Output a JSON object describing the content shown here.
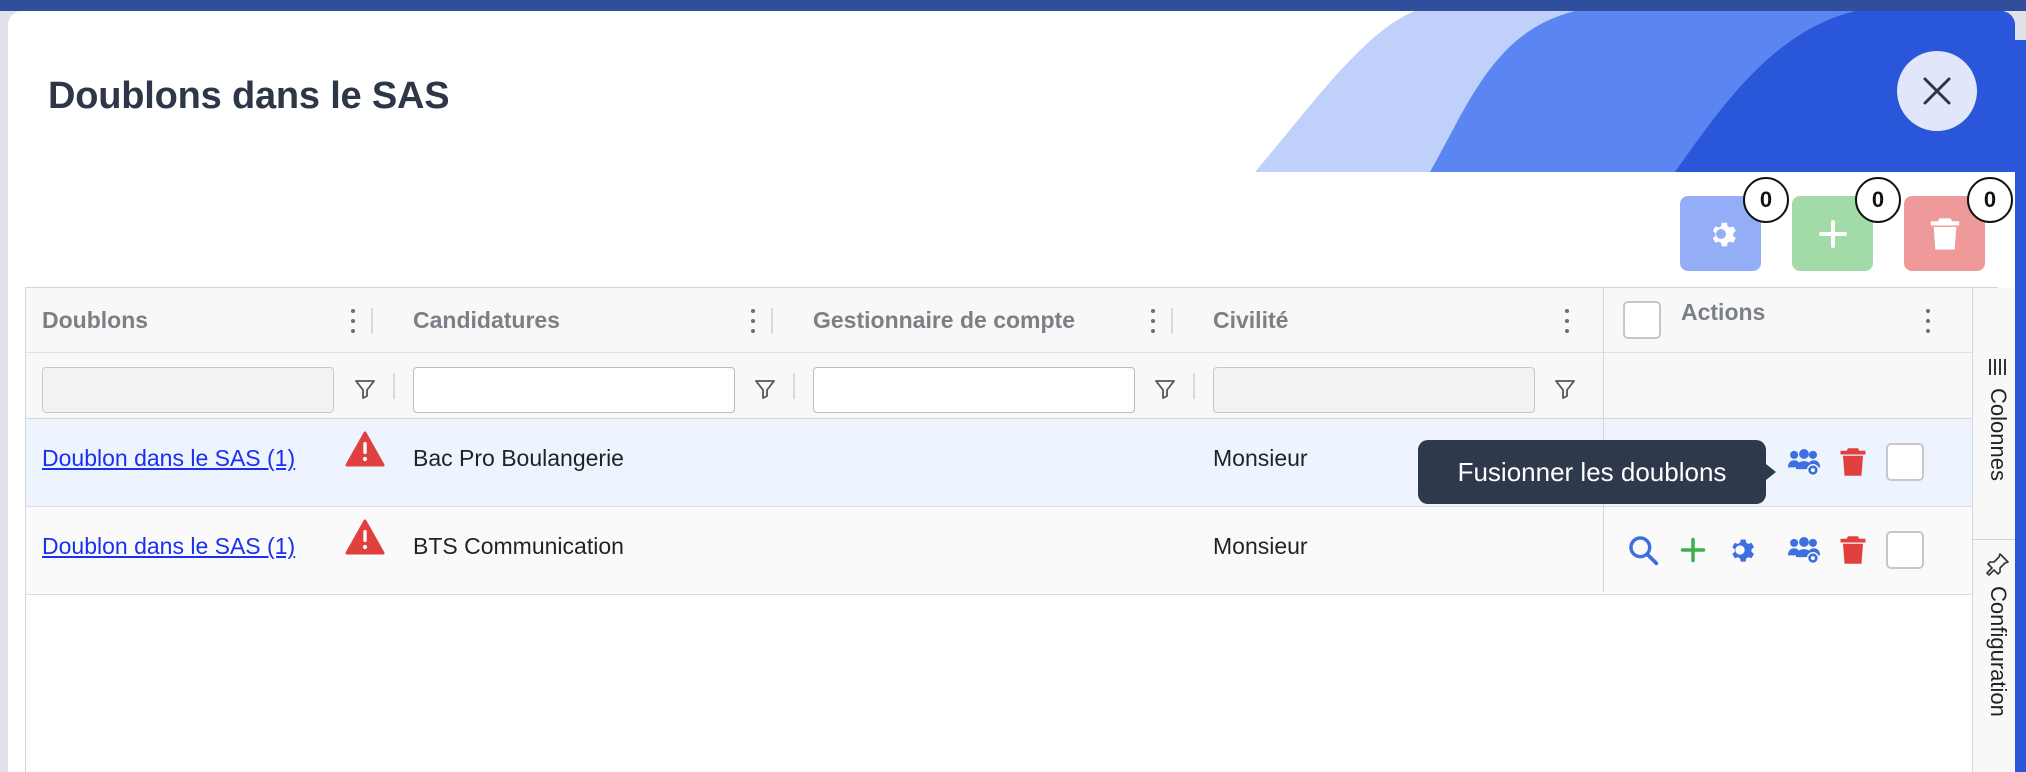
{
  "modal": {
    "title": "Doublons dans le SAS",
    "close_label": "close"
  },
  "toolbar": {
    "buttons": [
      {
        "icon": "gear-icon",
        "count": "0",
        "color": "#93aef7"
      },
      {
        "icon": "plus-icon",
        "count": "0",
        "color": "#a3dba8"
      },
      {
        "icon": "trash-icon",
        "count": "0",
        "color": "#ee9a9a"
      }
    ]
  },
  "grid": {
    "columns": [
      {
        "label": "Doublons"
      },
      {
        "label": "Candidatures"
      },
      {
        "label": "Gestionnaire de compte"
      },
      {
        "label": "Civilité"
      },
      {
        "label": "Actions"
      }
    ],
    "filters": {
      "doublons": "",
      "candidatures": "",
      "gestionnaire": "",
      "civilite": ""
    },
    "rows": [
      {
        "doublon": "Doublon dans le SAS (1)",
        "candidature": "Bac Pro Boulangerie",
        "gestionnaire": "",
        "civilite": "Monsieur"
      },
      {
        "doublon": "Doublon dans le SAS (1)",
        "candidature": "BTS Communication",
        "gestionnaire": "",
        "civilite": "Monsieur"
      }
    ]
  },
  "side_panel": {
    "tabs": [
      {
        "label": "Colonnes",
        "icon": "columns-icon"
      },
      {
        "label": "Configuration",
        "icon": "pin-icon"
      }
    ]
  },
  "tooltip": {
    "text": "Fusionner les doublons"
  },
  "colors": {
    "accent": "#2f6be0",
    "link": "#1a2ff0",
    "danger": "#e0413e",
    "success": "#3fae4a",
    "tooltip_bg": "#2e3a4b"
  }
}
